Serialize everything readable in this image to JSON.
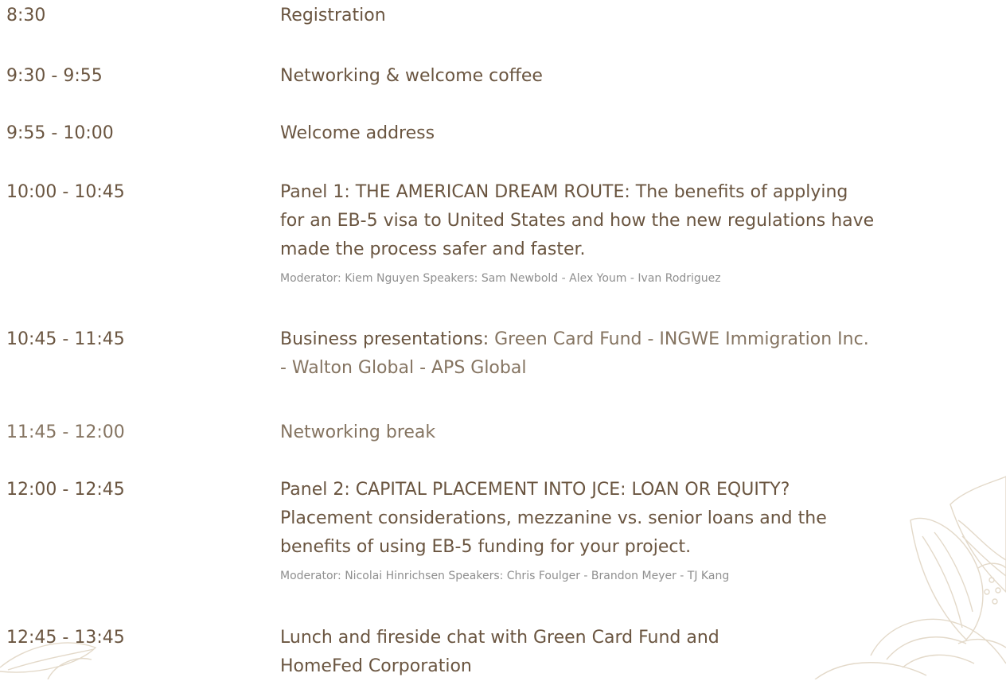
{
  "agenda": [
    {
      "time": "8:30",
      "title_lines": [
        "Registration"
      ]
    },
    {
      "time": "9:30 - 9:55",
      "title_lines": [
        "Networking & welcome coffee"
      ]
    },
    {
      "time": "9:55 - 10:00",
      "title_lines": [
        "Welcome address"
      ]
    },
    {
      "time": "10:00 - 10:45",
      "title_lines": [
        "Panel 1: THE AMERICAN DREAM ROUTE: The benefits of applying",
        "for an EB-5 visa to United States and how the new regulations have",
        "made the process safer and faster."
      ],
      "speakers": "Moderator: Kiem Nguyen Speakers: Sam Newbold - Alex Youm - Ivan Rodriguez"
    },
    {
      "time": "10:45 - 11:45",
      "label": "Business presentations:",
      "companies_line1": " Green Card Fund - INGWE Immigration Inc.",
      "companies_line2": "- Walton Global - APS Global"
    },
    {
      "time": "11:45 - 12:00",
      "title_lines": [
        "Networking break"
      ]
    },
    {
      "time": "12:00 - 12:45",
      "title_lines": [
        "Panel 2: CAPITAL PLACEMENT INTO JCE: LOAN OR EQUITY?",
        "Placement considerations, mezzanine vs. senior loans and the",
        "benefits of using EB-5 funding for your project."
      ],
      "speakers": "Moderator: Nicolai Hinrichsen Speakers: Chris Foulger - Brandon Meyer - TJ Kang"
    },
    {
      "time": "12:45 - 13:45",
      "title_lines": [
        "Lunch and fireside chat with Green Card Fund and",
        "HomeFed Corporation"
      ]
    }
  ],
  "decor": {
    "icon": "lotus-flower-icon",
    "line_color": "#e3d9c9"
  }
}
